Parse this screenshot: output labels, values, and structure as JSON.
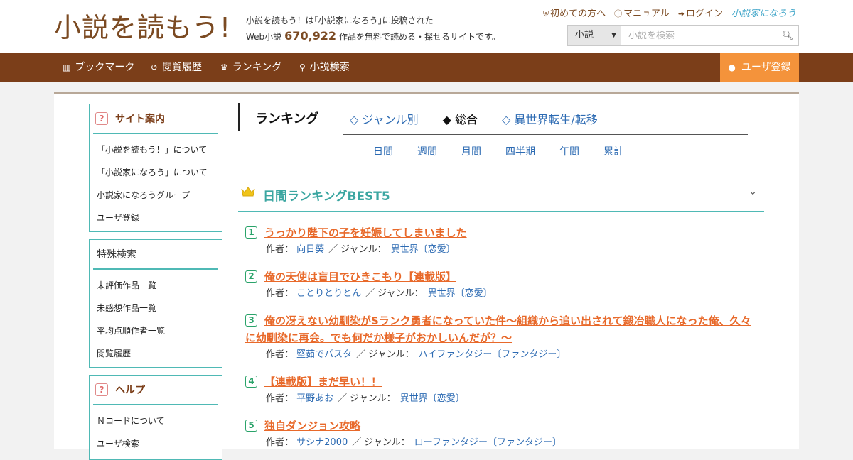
{
  "header": {
    "logo_main": "小説を読もう!",
    "tagline_line1": "小説を読もう！は｢小説家になろう｣に投稿された",
    "tagline_pre": "Web小説",
    "work_count": "670,922",
    "tagline_post": "作品を無料で読める・探せるサイトです。",
    "links": [
      {
        "icon": "shield-icon",
        "label": "初めての方へ"
      },
      {
        "icon": "question-icon",
        "label": "マニュアル"
      },
      {
        "icon": "login-icon",
        "label": "ログイン"
      }
    ],
    "narou_label": "小説家になろう",
    "search": {
      "select_value": "小説",
      "placeholder": "小説を検索"
    }
  },
  "nav": {
    "items": [
      {
        "icon": "bookmark-icon",
        "label": "ブックマーク"
      },
      {
        "icon": "history-icon",
        "label": "閲覧履歴"
      },
      {
        "icon": "crown-icon",
        "label": "ランキング"
      },
      {
        "icon": "search-icon",
        "label": "小説検索"
      }
    ],
    "register": "ユーザ登録"
  },
  "sidebar": {
    "site_guide": {
      "title": "サイト案内",
      "items": [
        "「小説を読もう！」について",
        "「小説家になろう」について",
        "小説家になろうグループ",
        "ユーザ登録"
      ]
    },
    "special_search": {
      "title": "特殊検索",
      "items": [
        "未評価作品一覧",
        "未感想作品一覧",
        "平均点順作者一覧",
        "閲覧履歴"
      ]
    },
    "help": {
      "title": "ヘルプ",
      "items": [
        "Ｎコードについて",
        "ユーザ検索"
      ]
    }
  },
  "ranking": {
    "heading": "ランキング",
    "genre_tabs": [
      {
        "label": "◇ ジャンル別",
        "active": false
      },
      {
        "label": "◆ 総合",
        "active": true
      },
      {
        "label": "◇ 異世界転生/転移",
        "active": false
      }
    ],
    "period_tabs": [
      "日間",
      "週間",
      "月間",
      "四半期",
      "年間",
      "累計"
    ],
    "best_title": "日間ランキングBEST5",
    "author_label": "作者：",
    "genre_label": "／ ジャンル：",
    "entries": [
      {
        "rank": "1",
        "title": "うっかり陛下の子を妊娠してしまいました",
        "author": "向日葵",
        "genre": "異世界〔恋愛〕"
      },
      {
        "rank": "2",
        "title": "俺の天使は盲目でひきこもり【連載版】",
        "author": "ことりとりとん",
        "genre": "異世界〔恋愛〕"
      },
      {
        "rank": "3",
        "title": "俺の冴えない幼馴染がSランク勇者になっていた件～組織から追い出されて鍛冶職人になった俺、久々に幼馴染に再会。でも何だか様子がおかしいんだが？～",
        "author": "堅茹でパスタ",
        "genre": "ハイファンタジー〔ファンタジー〕"
      },
      {
        "rank": "4",
        "title": "【連載版】まだ早い！！",
        "author": "平野あお",
        "genre": "異世界〔恋愛〕"
      },
      {
        "rank": "5",
        "title": "独自ダンジョン攻略",
        "author": "サシナ2000",
        "genre": "ローファンタジー〔ファンタジー〕"
      }
    ]
  },
  "colors": {
    "brand_brown": "#7b3e19",
    "accent_orange": "#f4933b",
    "teal": "#4fb9b5",
    "link_blue": "#2d6bb3",
    "title_orange": "#e8692a"
  }
}
